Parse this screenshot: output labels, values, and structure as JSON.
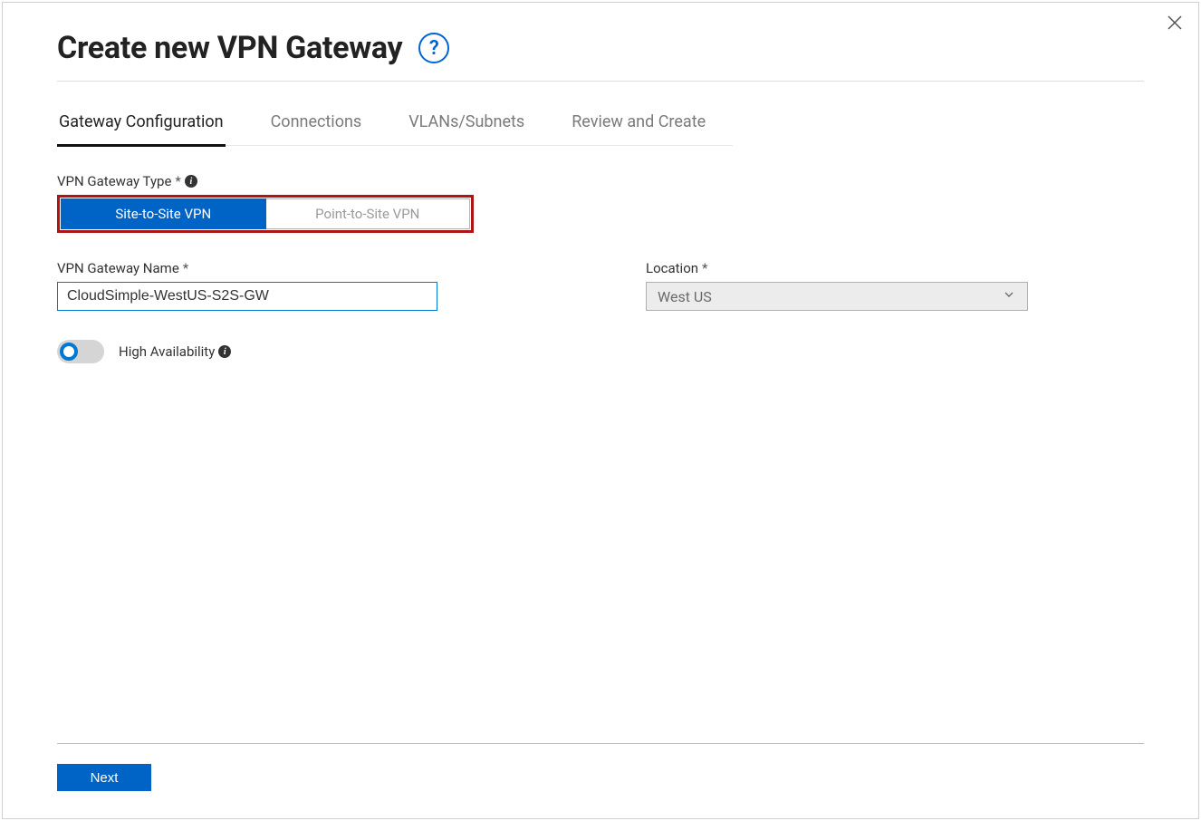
{
  "header": {
    "title": "Create new VPN Gateway",
    "help_glyph": "?"
  },
  "tabs": [
    {
      "label": "Gateway Configuration",
      "active": true
    },
    {
      "label": "Connections",
      "active": false
    },
    {
      "label": "VLANs/Subnets",
      "active": false
    },
    {
      "label": "Review and Create",
      "active": false
    }
  ],
  "gateway_type": {
    "label": "VPN Gateway Type",
    "required_marker": "*",
    "options": {
      "site_to_site": "Site-to-Site VPN",
      "point_to_site": "Point-to-Site VPN"
    },
    "selected": "site_to_site"
  },
  "gateway_name": {
    "label": "VPN Gateway Name",
    "required_marker": "*",
    "value": "CloudSimple-WestUS-S2S-GW"
  },
  "location": {
    "label": "Location",
    "required_marker": "*",
    "value": "West US"
  },
  "ha": {
    "label": "High Availability",
    "enabled": false
  },
  "footer": {
    "next_label": "Next"
  }
}
